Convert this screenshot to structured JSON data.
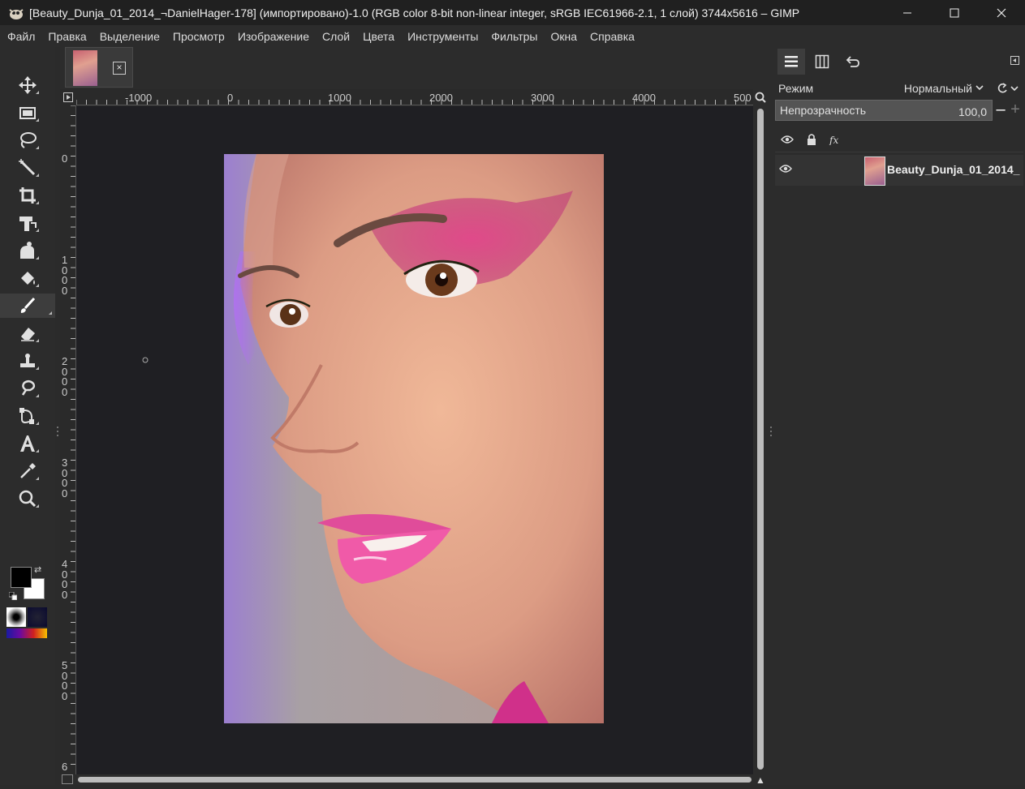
{
  "window": {
    "title": "[Beauty_Dunja_01_2014_¬DanielHager-178] (импортировано)-1.0 (RGB color 8-bit non-linear integer, sRGB IEC61966-2.1, 1 слой) 3744x5616 – GIMP",
    "minimize_icon": "minimize-icon",
    "maximize_icon": "maximize-icon",
    "close_icon": "close-icon"
  },
  "menubar": {
    "items": [
      "Файл",
      "Правка",
      "Выделение",
      "Просмотр",
      "Изображение",
      "Слой",
      "Цвета",
      "Инструменты",
      "Фильтры",
      "Окна",
      "Справка"
    ]
  },
  "toolbox": {
    "tools": [
      {
        "name": "move-tool-icon"
      },
      {
        "name": "rect-select-tool-icon"
      },
      {
        "name": "lasso-tool-icon"
      },
      {
        "name": "fuzzy-select-tool-icon"
      },
      {
        "name": "crop-tool-icon"
      },
      {
        "name": "transform-tool-icon"
      },
      {
        "name": "warp-tool-icon"
      },
      {
        "name": "bucket-fill-tool-icon"
      },
      {
        "name": "paintbrush-tool-icon",
        "active": true
      },
      {
        "name": "eraser-tool-icon"
      },
      {
        "name": "clone-tool-icon"
      },
      {
        "name": "smudge-tool-icon"
      },
      {
        "name": "paths-tool-icon"
      },
      {
        "name": "text-tool-icon"
      },
      {
        "name": "color-picker-tool-icon"
      },
      {
        "name": "zoom-tool-icon"
      }
    ],
    "fg_color": "#000000",
    "bg_color": "#ffffff"
  },
  "rulers": {
    "horizontal_labels": [
      "-1000",
      "0",
      "1000",
      "2000",
      "3000",
      "4000",
      "500"
    ],
    "vertical_labels": [
      "0",
      "1000",
      "2000",
      "3000",
      "4000",
      "5000",
      "6"
    ]
  },
  "layers_panel": {
    "mode_label": "Режим",
    "mode_value": "Нормальный",
    "opacity_label": "Непрозрачность",
    "opacity_value": "100,0",
    "opacity_percent": 100,
    "layers": [
      {
        "name": "Beauty_Dunja_01_2014_"
      }
    ]
  }
}
